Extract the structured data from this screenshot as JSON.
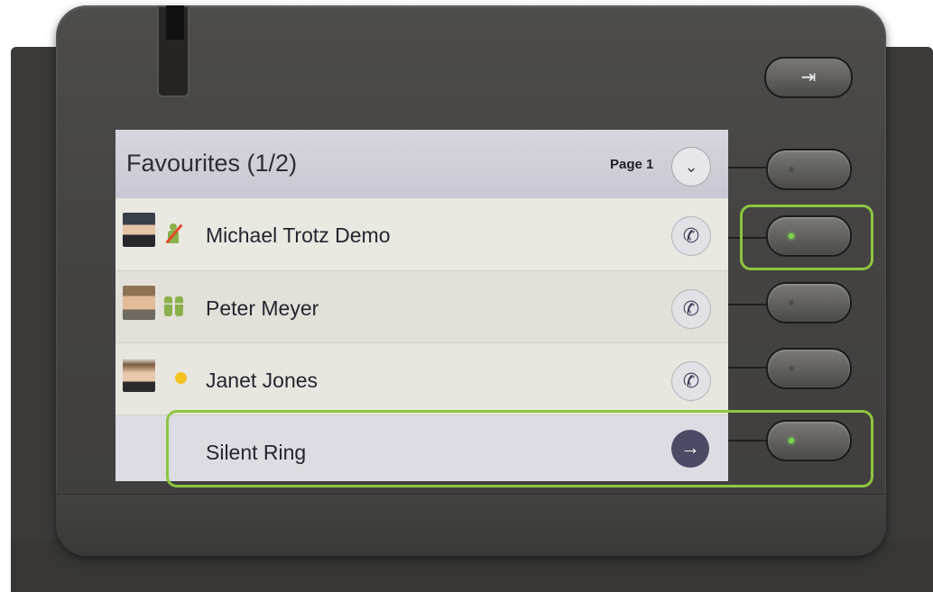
{
  "header": {
    "title": "Favourites (1/2)",
    "page_label": "Page 1",
    "page_icon": "chevron-down-icon"
  },
  "contacts": [
    {
      "name": "Michael Trotz Demo",
      "presence": "busy",
      "action_icon": "phone-icon"
    },
    {
      "name": "Peter Meyer",
      "presence": "available",
      "action_icon": "phone-icon"
    },
    {
      "name": "Janet Jones",
      "presence": "away",
      "action_icon": "phone-icon"
    }
  ],
  "silent_ring": {
    "label": "Silent Ring",
    "action_icon": "arrow-right-icon"
  },
  "keys": {
    "top_key_icon": "exit-icon",
    "leds": [
      "off",
      "on",
      "off",
      "off",
      "on"
    ]
  },
  "glyphs": {
    "chevron": "⌄",
    "phone": "✆",
    "arrow": "→",
    "exit": "⇥"
  },
  "colors": {
    "highlight": "#8cc63f",
    "led_on": "#7ad64a",
    "presence_available": "#8ab04a",
    "presence_away": "#f2c21f",
    "presence_busy_slash": "#e24a2a"
  }
}
